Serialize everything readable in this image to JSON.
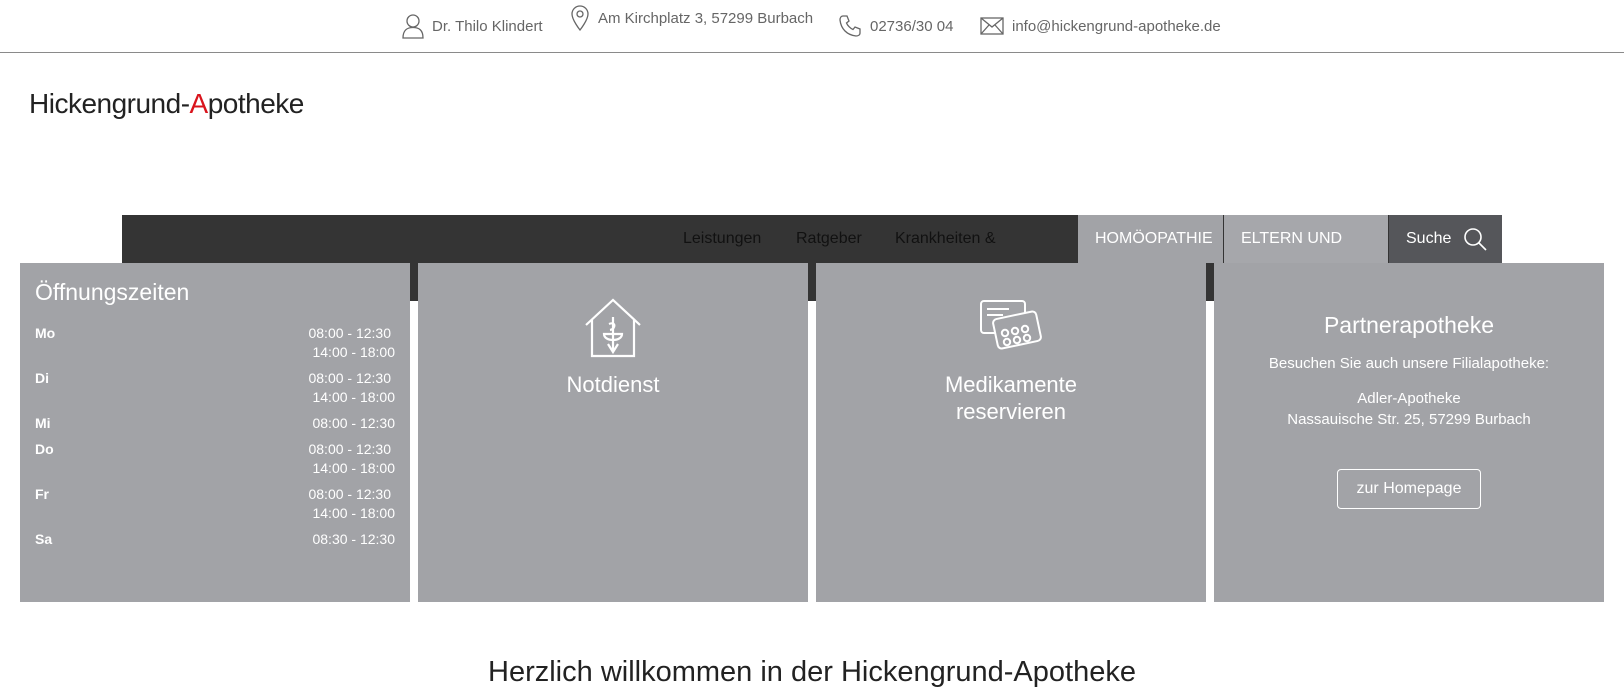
{
  "contact": {
    "owner": "Dr. Thilo Klindert",
    "address": "Am Kirchplatz 3, 57299 Burbach",
    "phone": "02736/30 04",
    "email": "info@hickengrund-apotheke.de"
  },
  "logo": {
    "part1": "Hickengrund-",
    "red": "A",
    "part2": "potheke"
  },
  "nav": {
    "links": [
      "Leistungen",
      "Ratgeber",
      "Krankheiten &"
    ],
    "tabs": [
      "HOMÖOPATHIE",
      "ELTERN UND"
    ],
    "search_label": "Suche"
  },
  "hours": {
    "title": "Öffnungszeiten",
    "rows": [
      {
        "day": "Mo",
        "times": [
          "08:00 - 12:30",
          "14:00 - 18:00"
        ]
      },
      {
        "day": "Di",
        "times": [
          "08:00 - 12:30",
          "14:00 - 18:00"
        ]
      },
      {
        "day": "Mi",
        "times": [
          "08:00 - 12:30"
        ]
      },
      {
        "day": "Do",
        "times": [
          "08:00 - 12:30",
          "14:00 - 18:00"
        ]
      },
      {
        "day": "Fr",
        "times": [
          "08:00 - 12:30",
          "14:00 - 18:00"
        ]
      },
      {
        "day": "Sa",
        "times": [
          "08:30 - 12:30"
        ]
      }
    ]
  },
  "tiles": {
    "notdienst": "Notdienst",
    "reservieren_line1": "Medikamente",
    "reservieren_line2": "reservieren"
  },
  "partner": {
    "title": "Partnerapotheke",
    "intro": "Besuchen Sie auch unsere Filialapotheke:",
    "name": "Adler-Apotheke",
    "address": "Nassauische Str. 25, 57299 Burbach",
    "button": "zur Homepage"
  },
  "welcome": "Herzlich willkommen in der Hickengrund-Apotheke"
}
